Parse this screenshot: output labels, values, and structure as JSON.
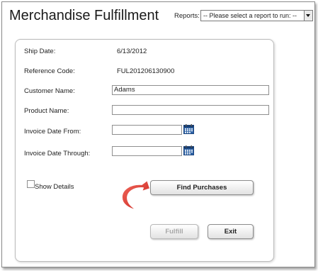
{
  "header": {
    "title": "Merchandise Fulfillment",
    "reports_label": "Reports:",
    "reports_selected": "-- Please select a report to run: --"
  },
  "form": {
    "ship_date_label": "Ship Date:",
    "ship_date_value": "6/13/2012",
    "reference_code_label": "Reference Code:",
    "reference_code_value": "FUL201206130900",
    "customer_name_label": "Customer Name:",
    "customer_name_value": "Adams",
    "product_name_label": "Product Name:",
    "product_name_value": "",
    "invoice_date_from_label": "Invoice Date From:",
    "invoice_date_from_value": "",
    "invoice_date_through_label": "Invoice Date Through:",
    "invoice_date_through_value": "",
    "show_details_label": "Show Details",
    "show_details_checked": false
  },
  "buttons": {
    "find_purchases": "Find Purchases",
    "fulfill": "Fulfill",
    "exit": "Exit"
  },
  "icons": {
    "calendar": "calendar-icon",
    "callout_arrow": "curved-arrow-icon"
  },
  "colors": {
    "calendar_blue": "#2f64a8",
    "arrow_red": "#e0352f"
  }
}
